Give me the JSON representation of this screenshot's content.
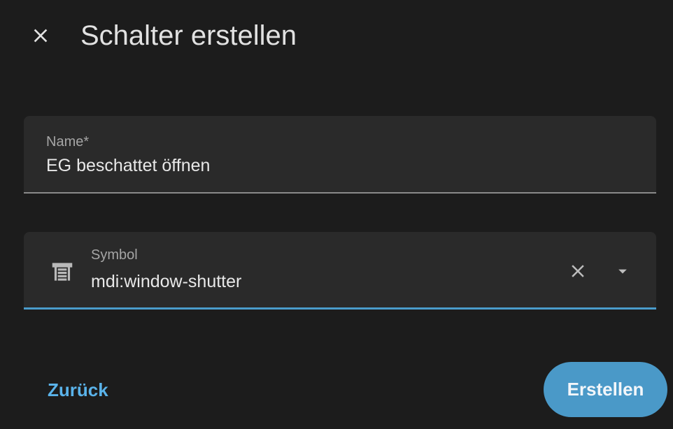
{
  "dialog": {
    "title": "Schalter erstellen",
    "close_icon": "close-icon"
  },
  "fields": {
    "name": {
      "label": "Name*",
      "value": "EG beschattet öffnen"
    },
    "symbol": {
      "label": "Symbol",
      "value": "mdi:window-shutter",
      "icon": "window-shutter-icon",
      "clear_icon": "close-icon",
      "dropdown_icon": "chevron-down-icon"
    }
  },
  "actions": {
    "back_label": "Zurück",
    "create_label": "Erstellen"
  },
  "colors": {
    "background": "#1c1c1c",
    "field_background": "#2a2a2a",
    "accent": "#4a9ccb",
    "link": "#5ab3ea",
    "primary_button": "#4a99c8"
  }
}
